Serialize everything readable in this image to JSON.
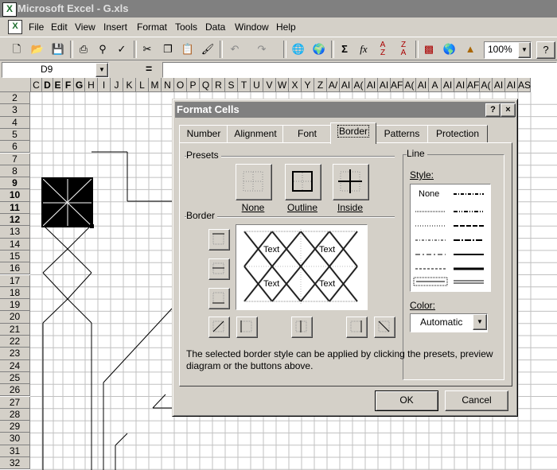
{
  "window": {
    "title": "Microsoft Excel - G.xls"
  },
  "menu": [
    "File",
    "Edit",
    "View",
    "Insert",
    "Format",
    "Tools",
    "Data",
    "Window",
    "Help"
  ],
  "toolbar": {
    "zoom": "100%",
    "sum_glyph": "Σ",
    "fx_glyph": "fx",
    "help_glyph": "?"
  },
  "formula_bar": {
    "name_box": "D9",
    "equals": "="
  },
  "columns": [
    "C",
    "D",
    "E",
    "F",
    "G",
    "H",
    "I",
    "J",
    "K",
    "L",
    "M",
    "N",
    "O",
    "P",
    "Q",
    "R",
    "S",
    "T",
    "U",
    "V",
    "W",
    "X",
    "Y",
    "Z",
    "A/",
    "AI",
    "A(",
    "AI",
    "AI",
    "AF",
    "A(",
    "AI",
    "A",
    "AI",
    "AI",
    "AF",
    "A(",
    "AI",
    "AI",
    "AS"
  ],
  "rows": [
    "2",
    "3",
    "4",
    "5",
    "6",
    "7",
    "8",
    "9",
    "10",
    "11",
    "12",
    "13",
    "14",
    "15",
    "16",
    "17",
    "18",
    "19",
    "20",
    "21",
    "22",
    "23",
    "24",
    "25",
    "26",
    "27",
    "28",
    "29",
    "30",
    "31",
    "32"
  ],
  "dialog": {
    "title": "Format Cells",
    "help_btn": "?",
    "close_btn": "×",
    "tabs": [
      "Number",
      "Alignment",
      "Font",
      "Border",
      "Patterns",
      "Protection"
    ],
    "active_tab": "Border",
    "presets_label": "Presets",
    "presets": [
      "None",
      "Outline",
      "Inside"
    ],
    "border_label": "Border",
    "preview_text": [
      "Text",
      "Text",
      "Text",
      "Text"
    ],
    "line_label": "Line",
    "style_label": "Style:",
    "style_none": "None",
    "color_label": "Color:",
    "color_value": "Automatic",
    "hint": "The selected border style can be applied by clicking the presets, preview diagram or the buttons above.",
    "ok": "OK",
    "cancel": "Cancel"
  }
}
